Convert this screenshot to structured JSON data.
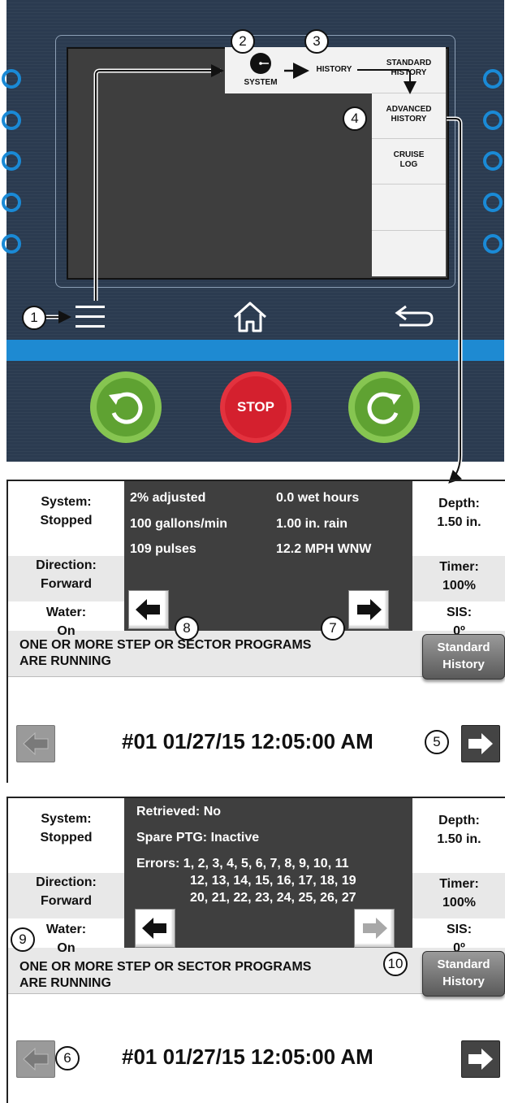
{
  "menu": {
    "system_label": "SYSTEM",
    "history_label": "HISTORY",
    "standard_history": [
      "STANDARD",
      "HISTORY"
    ],
    "advanced_history": [
      "ADVANCED",
      "HISTORY"
    ],
    "cruise_log": [
      "CRUISE",
      "LOG"
    ]
  },
  "controls": {
    "stop_label": "STOP"
  },
  "callouts": [
    "1",
    "2",
    "3",
    "4",
    "5",
    "6",
    "7",
    "8",
    "9",
    "10"
  ],
  "panel1": {
    "system_label": "System:",
    "system_value": "Stopped",
    "direction_label": "Direction:",
    "direction_value": "Forward",
    "water_label": "Water:",
    "water_value": "On",
    "depth_label": "Depth:",
    "depth_value": "1.50 in.",
    "timer_label": "Timer:",
    "timer_value": "100%",
    "sis_label": "SIS:",
    "sis_value": "0º",
    "stats_left": [
      "2% adjusted",
      "100 gallons/min",
      "109 pulses"
    ],
    "stats_right": [
      "0.0 wet hours",
      "1.00 in. rain",
      "12.2 MPH WNW"
    ],
    "message_line1": "ONE OR MORE STEP OR SECTOR PROGRAMS",
    "message_line2": "ARE RUNNING",
    "button_line1": "Standard",
    "button_line2": "History",
    "footer_record": "#01  01/27/15  12:05:00 AM"
  },
  "panel2": {
    "system_label": "System:",
    "system_value": "Stopped",
    "direction_label": "Direction:",
    "direction_value": "Forward",
    "water_label": "Water:",
    "water_value": "On",
    "depth_label": "Depth:",
    "depth_value": "1.50 in.",
    "timer_label": "Timer:",
    "timer_value": "100%",
    "sis_label": "SIS:",
    "sis_value": "0º",
    "retrieved": "Retrieved: No",
    "spare_ptg": "Spare PTG: Inactive",
    "errors_line1": "Errors: 1, 2, 3, 4, 5, 6, 7, 8, 9, 10, 11",
    "errors_line2": "12, 13, 14, 15, 16, 17, 18, 19",
    "errors_line3": "20, 21, 22, 23, 24, 25, 26, 27",
    "message_line1": "ONE OR MORE STEP OR SECTOR PROGRAMS",
    "message_line2": "ARE RUNNING",
    "button_line1": "Standard",
    "button_line2": "History",
    "footer_record": "#01  01/27/15  12:05:00 AM"
  },
  "colors": {
    "device_bg": "#2b3b50",
    "accent_blue": "#1e8ad2",
    "stop_red": "#d9202f",
    "rotate_green": "#6cb33f",
    "panel_dark": "#3f3f3f"
  },
  "icons": [
    "menu-icon",
    "home-icon",
    "back-icon",
    "rotate-left-icon",
    "rotate-right-icon",
    "arrow-left-icon",
    "arrow-right-icon",
    "system-dot-icon"
  ]
}
